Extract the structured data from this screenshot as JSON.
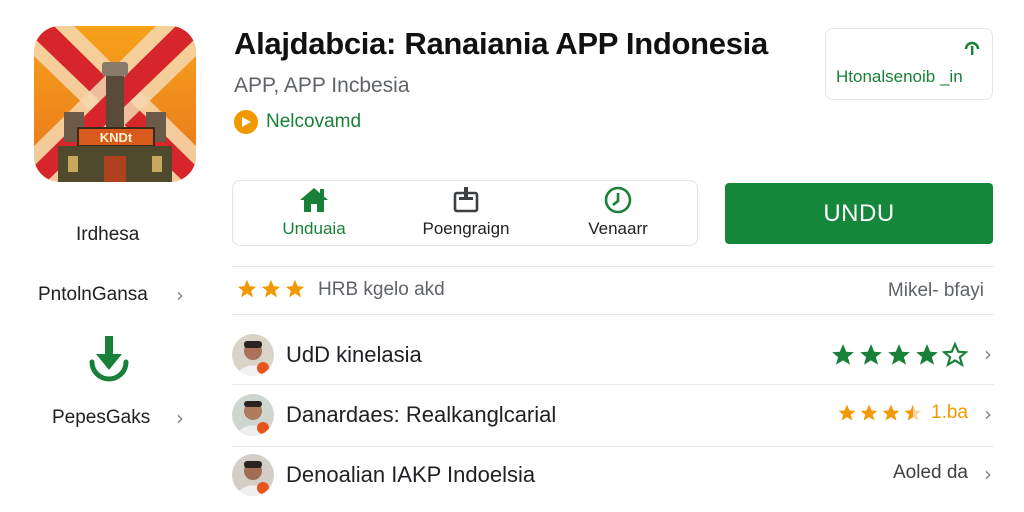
{
  "app": {
    "title": "Alajdabcia: Ranaiania APP Indonesia",
    "subtitle": "APP, APP Incbesia",
    "developer": "Nelcovamd",
    "install_label": "UNDU"
  },
  "left_panel": {
    "country_label": "Irdhesa",
    "link1_label": "PntolnGansa",
    "link2_label": "PepesGaks",
    "download_icon": "download-icon"
  },
  "top_card": {
    "text": "Htonalsenoib _in",
    "icon": "info-icon"
  },
  "actions": [
    {
      "label": "Unduaia",
      "icon": "home-icon",
      "color": "#188038"
    },
    {
      "label": "Poengraign",
      "icon": "share-icon",
      "color": "#202124"
    },
    {
      "label": "Venaarr",
      "icon": "clock-icon",
      "color": "#202124"
    }
  ],
  "rating_summary": {
    "stars": 3,
    "text": "HRB kgelo akd",
    "right": "Mikel- bfayi"
  },
  "reviews": [
    {
      "name": "UdD kinelasia",
      "stars_filled": 4,
      "stars_total": 5,
      "star_color": "#188038",
      "right_text": ""
    },
    {
      "name": "Danardaes: Realkanglcarial",
      "stars_filled": 3.5,
      "stars_total": 4,
      "star_color": "#f29900",
      "right_text": "1.ba"
    },
    {
      "name": "Denoalian IAKP Indoelsia",
      "stars_filled": 0,
      "stars_total": 0,
      "star_color": "#f29900",
      "right_text": "Aoled da"
    }
  ],
  "colors": {
    "accent_green": "#14873a",
    "text_green": "#188038",
    "star_orange": "#f29900"
  }
}
